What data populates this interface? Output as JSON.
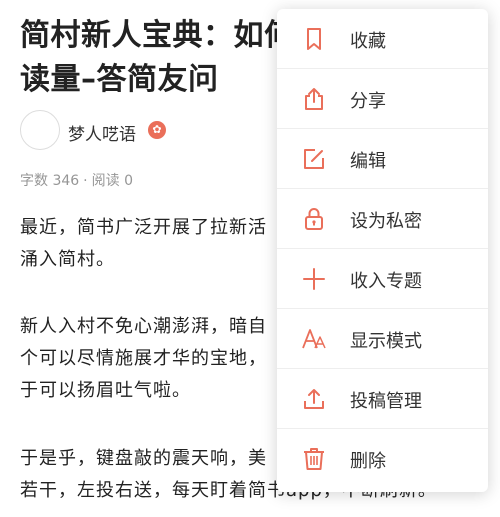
{
  "article": {
    "title_line1": "简村新人宝典：如何",
    "title_line2": "读量–答简友问",
    "author": {
      "name": "梦人呓语",
      "badge_glyph": "✿"
    },
    "meta": {
      "word_count": "字数 346",
      "separator": "·",
      "reads": "阅读 0"
    },
    "paragraphs": [
      [
        "最近，简书广泛开展了拉新活",
        "涌入简村。"
      ],
      [
        "新人入村不免心潮澎湃，暗自",
        "个可以尽情施展才华的宝地，",
        "于可以扬眉吐气啦。"
      ],
      [
        "于是乎，键盘敲的震天响，美",
        "若干，左投右送，每天盯着简书app，不断刷新。"
      ]
    ]
  },
  "menu": {
    "accent_color": "#ea6f5a",
    "items": [
      {
        "label": "收藏",
        "icon": "bookmark-icon"
      },
      {
        "label": "分享",
        "icon": "share-icon"
      },
      {
        "label": "编辑",
        "icon": "edit-icon"
      },
      {
        "label": "设为私密",
        "icon": "lock-icon"
      },
      {
        "label": "收入专题",
        "icon": "plus-icon"
      },
      {
        "label": "显示模式",
        "icon": "font-size-icon"
      },
      {
        "label": "投稿管理",
        "icon": "upload-icon"
      },
      {
        "label": "删除",
        "icon": "trash-icon"
      }
    ]
  }
}
